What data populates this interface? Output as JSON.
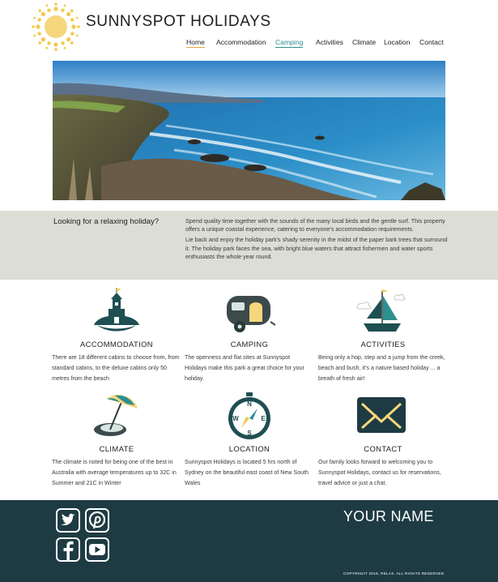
{
  "site": {
    "title": "SUNNYSPOT HOLIDAYS"
  },
  "nav": {
    "items": [
      {
        "label": "Home"
      },
      {
        "label": "Accommodation"
      },
      {
        "label": "Camping"
      },
      {
        "label": "Activities"
      },
      {
        "label": "Climate"
      },
      {
        "label": "Location"
      },
      {
        "label": "Contact"
      }
    ]
  },
  "intro": {
    "heading": "Looking for a relaxing holiday?",
    "paragraph1": "Spend quality time together with the sounds of the many local birds and the gentle surf. This property offers a unique coastal experience, catering to everyone's accommodation requirements.",
    "paragraph2": "Lie back and enjoy the holiday park's shady serenity in the midst of the paper bark trees that surround it. The holiday park faces the sea, with bright blue waters that attract fishermen and water sports enthusiasts the whole year round."
  },
  "features": [
    {
      "title": "ACCOMMODATION",
      "icon": "castle-icon",
      "text": "There are 18 different cabins to choose from, from standard cabins, to the deluxe cabins only 50 metres from the beach"
    },
    {
      "title": "CAMPING",
      "icon": "caravan-icon",
      "text": "The openness and flat sites at Sunnyspot Holidays make this park a great choice for your holiday."
    },
    {
      "title": "ACTIVITIES",
      "icon": "sailboat-icon",
      "text": "Being only a hop, step and a jump from the creek, beach and bush, it's a nature based holiday ... a breath of fresh air!"
    },
    {
      "title": "CLIMATE",
      "icon": "beach-umbrella-icon",
      "text": "The climate is noted for being one of the best in Australia with average temperatures up to 32C in Summer and 21C in Winter"
    },
    {
      "title": "LOCATION",
      "icon": "compass-icon",
      "text": "Sunnyspot Holidays is located 5 hrs north of Sydney on the beautiful east coast of New South Wales"
    },
    {
      "title": "CONTACT",
      "icon": "envelope-icon",
      "text": "Our family looks forward to welcoming you to Sunnyspot Holidays, contact us for reservations, travel advice or just a chat."
    }
  ],
  "footer": {
    "name": "YOUR NAME",
    "copyright": "COPYRIGHT 2018, RELAX. ALL RIGHTS RESERVED",
    "social": [
      "twitter-icon",
      "pinterest-icon",
      "facebook-icon",
      "youtube-icon"
    ]
  },
  "colors": {
    "accent_teal": "#2e8f8f",
    "nav_underline": "#e8a640",
    "intro_bg": "#dcddd5",
    "footer_bg": "#1e3b43",
    "sun": "#f2c94c"
  }
}
